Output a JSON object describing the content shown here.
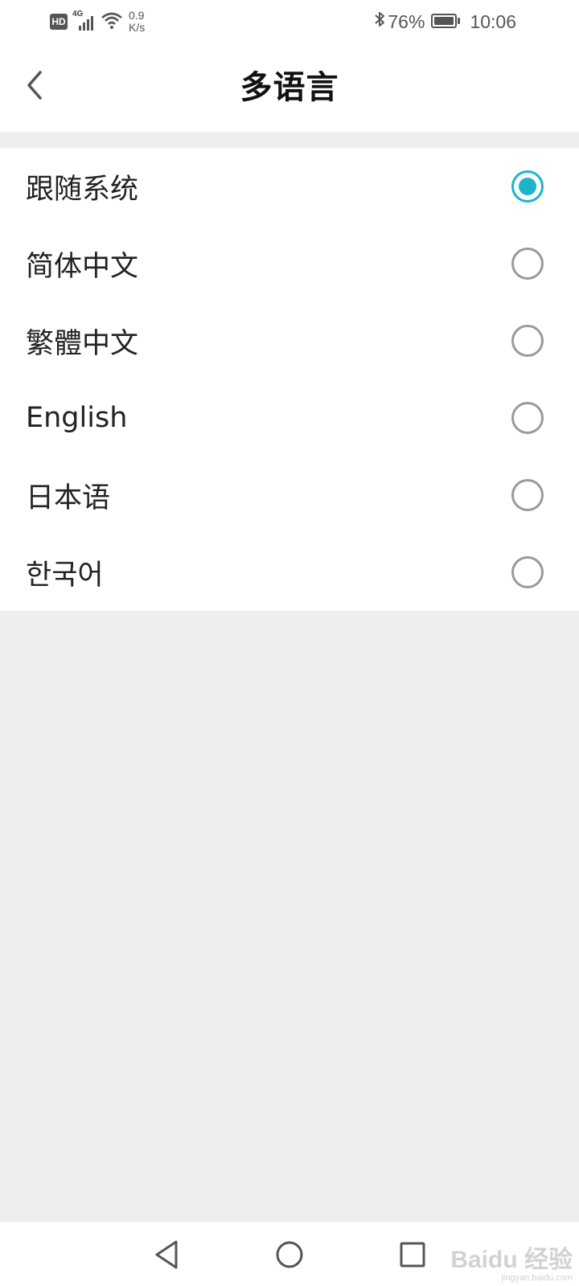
{
  "status_bar": {
    "hd": "HD",
    "network_gen": "4G",
    "speed_value": "0.9",
    "speed_unit": "K/s",
    "battery_percent": "76%",
    "time": "10:06"
  },
  "header": {
    "title": "多语言"
  },
  "languages": [
    {
      "label": "跟随系统",
      "selected": true
    },
    {
      "label": "简体中文",
      "selected": false
    },
    {
      "label": "繁體中文",
      "selected": false
    },
    {
      "label": "English",
      "selected": false
    },
    {
      "label": "日本语",
      "selected": false
    },
    {
      "label": "한국어",
      "selected": false
    }
  ],
  "colors": {
    "accent": "#1bb5c9",
    "background": "#ededed"
  },
  "watermark": {
    "brand": "Baidu 经验",
    "url": "jingyan.baidu.com"
  }
}
